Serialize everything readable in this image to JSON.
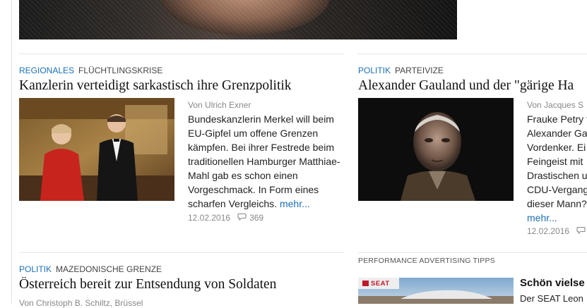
{
  "articles": [
    {
      "category": "REGIONALES",
      "topic": "FLÜCHTLINGSKRISE",
      "headline": "Kanzlerin verteidigt sarkastisch ihre Grenzpolitik",
      "byline": "Von Ulrich Exner",
      "teaser": "Bundeskanzlerin Merkel will beim EU-Gipfel um offene Grenzen kämpfen. Bei ihrer Festrede beim traditionellen Hamburger Matthiae-Mahl gab es schon einen Vorgeschmack. In Form eines scharfen Vergleichs.",
      "more": "mehr...",
      "date": "12.02.2016",
      "comments": "369"
    },
    {
      "category": "POLITIK",
      "topic": "PARTEIVIZE",
      "headline": "Alexander Gauland und der \"gärige Ha",
      "byline": "Von Jacques S",
      "teaser_lines": [
        "Frauke Petry t",
        "Alexander Ga",
        "Vordenker. Ei",
        "Feingeist mit",
        "Drastischen u",
        "CDU-Vergang",
        "dieser Mann?"
      ],
      "more": "mehr...",
      "date": "12.02.2016"
    },
    {
      "category": "POLITIK",
      "topic": "MAZEDONISCHE GRENZE",
      "headline": "Österreich bereit zur Entsendung von Soldaten",
      "byline": "Von Christoph B. Schiltz, Brüssel"
    }
  ],
  "ad": {
    "label": "PERFORMANCE ADVERTISING TIPPS",
    "brand": "SEAT",
    "title": "Schön vielse",
    "text": "Der SEAT Leon"
  },
  "icons": {
    "comment": "comment-bubble-icon"
  }
}
